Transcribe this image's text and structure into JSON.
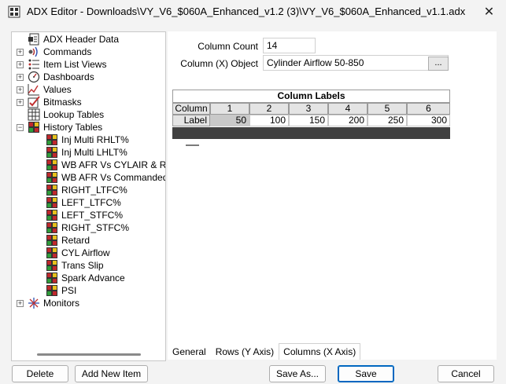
{
  "window": {
    "title": "ADX Editor - Downloads\\VY_V6_$060A_Enhanced_v1.2 (3)\\VY_V6_$060A_Enhanced_v1.1.adx",
    "close_glyph": "✕"
  },
  "tree": {
    "items": [
      {
        "label": "ADX Header Data",
        "icon": "header-data-icon",
        "expandable": false
      },
      {
        "label": "Commands",
        "icon": "commands-icon",
        "expandable": true
      },
      {
        "label": "Item List Views",
        "icon": "list-views-icon",
        "expandable": true
      },
      {
        "label": "Dashboards",
        "icon": "dashboards-icon",
        "expandable": true
      },
      {
        "label": "Values",
        "icon": "values-icon",
        "expandable": true
      },
      {
        "label": "Bitmasks",
        "icon": "bitmasks-icon",
        "expandable": true
      },
      {
        "label": "Lookup Tables",
        "icon": "lookup-tables-icon",
        "expandable": false
      },
      {
        "label": "History Tables",
        "icon": "history-tables-icon",
        "expandable": true,
        "expanded": true
      },
      {
        "label": "Monitors",
        "icon": "monitors-icon",
        "expandable": true
      }
    ],
    "history_children": [
      "Inj Multi RHLT%",
      "Inj Multi LHLT%",
      "WB AFR Vs CYLAIR & RPM",
      "WB AFR Vs Commanded AFI",
      "RIGHT_LTFC%",
      "LEFT_LTFC%",
      "LEFT_STFC%",
      "RIGHT_STFC%",
      "Retard",
      "CYL Airflow",
      "Trans Slip",
      "Spark Advance",
      "PSI"
    ],
    "expander_plus": "+",
    "expander_minus": "−"
  },
  "form": {
    "column_count_label": "Column Count",
    "column_count_value": "14",
    "column_object_label": "Column (X) Object",
    "column_object_value": "Cylinder Airflow 50-850",
    "browse_label": "..."
  },
  "grid": {
    "title": "Column Labels",
    "row_header": "Column",
    "label_header": "Label",
    "columns": [
      "1",
      "2",
      "3",
      "4",
      "5",
      "6"
    ],
    "labels": [
      "50",
      "100",
      "150",
      "200",
      "250",
      "300"
    ]
  },
  "tabs": [
    {
      "label": "General",
      "active": false
    },
    {
      "label": "Rows (Y Axis)",
      "active": false
    },
    {
      "label": "Columns (X Axis)",
      "active": true
    }
  ],
  "buttons": {
    "delete": "Delete",
    "add_new_item": "Add New Item",
    "save_as": "Save As...",
    "save": "Save",
    "cancel": "Cancel"
  },
  "colors": {
    "accent": "#0067c0",
    "history_icon_red": "#c0282d",
    "history_icon_green": "#2e9d3a",
    "history_icon_yellow": "#e8c21c"
  }
}
